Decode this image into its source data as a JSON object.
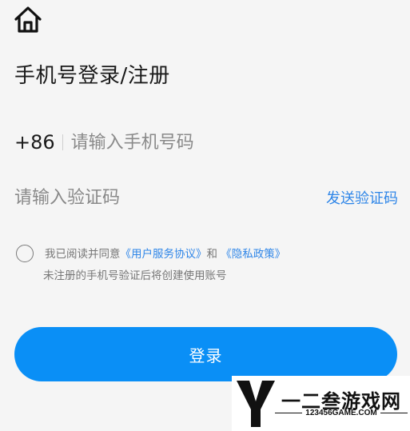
{
  "header": {
    "home_icon": "home-icon"
  },
  "page": {
    "title": "手机号登录/注册"
  },
  "phone": {
    "country_code": "+86",
    "placeholder": "请输入手机号码"
  },
  "code": {
    "placeholder": "请输入验证码",
    "send_label": "发送验证码"
  },
  "agreement": {
    "prefix": "我已阅读并同意",
    "user_agreement": "《用户服务协议》",
    "conjunction": "和",
    "privacy_policy": "《隐私政策》",
    "note": "未注册的手机号验证后将创建使用账号"
  },
  "login": {
    "label": "登录"
  },
  "watermark": {
    "name": "一二叁游戏网",
    "url": "123456GAME.COM"
  },
  "colors": {
    "accent": "#0a8ff6",
    "link": "#2f86e8",
    "background": "#f5f5f5"
  }
}
